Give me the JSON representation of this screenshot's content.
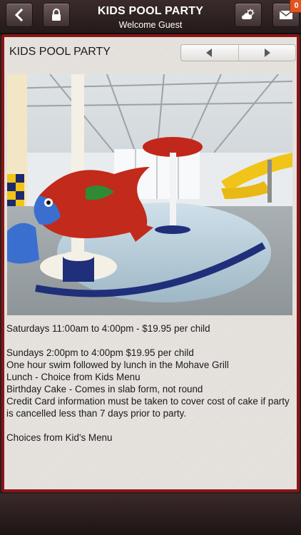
{
  "header": {
    "title": "KIDS POOL PARTY",
    "subtitle": "Welcome Guest",
    "back_icon": "chevron-left-icon",
    "lock_icon": "lock-icon",
    "weather_icon": "weather-icon",
    "mail_icon": "mail-icon",
    "mail_badge": "0"
  },
  "content": {
    "title": "KIDS POOL PARTY",
    "lines": [
      "Saturdays 11:00am to 4:00pm - $19.95 per child",
      "Sundays 2:00pm to 4:00pm $19.95 per child",
      "One hour swim followed by lunch in the Mohave Grill",
      "Lunch - Choice from Kids Menu",
      "Birthday Cake - Comes in slab form, not round",
      "Credit Card information must be taken to cover cost of cake if party is cancelled less than 7 days prior to party.",
      "Choices from Kid's Menu"
    ]
  },
  "colors": {
    "frame": "#8a1515",
    "background": "#e6e2de",
    "badge": "#e2541c",
    "topbar": "#2f2222"
  }
}
